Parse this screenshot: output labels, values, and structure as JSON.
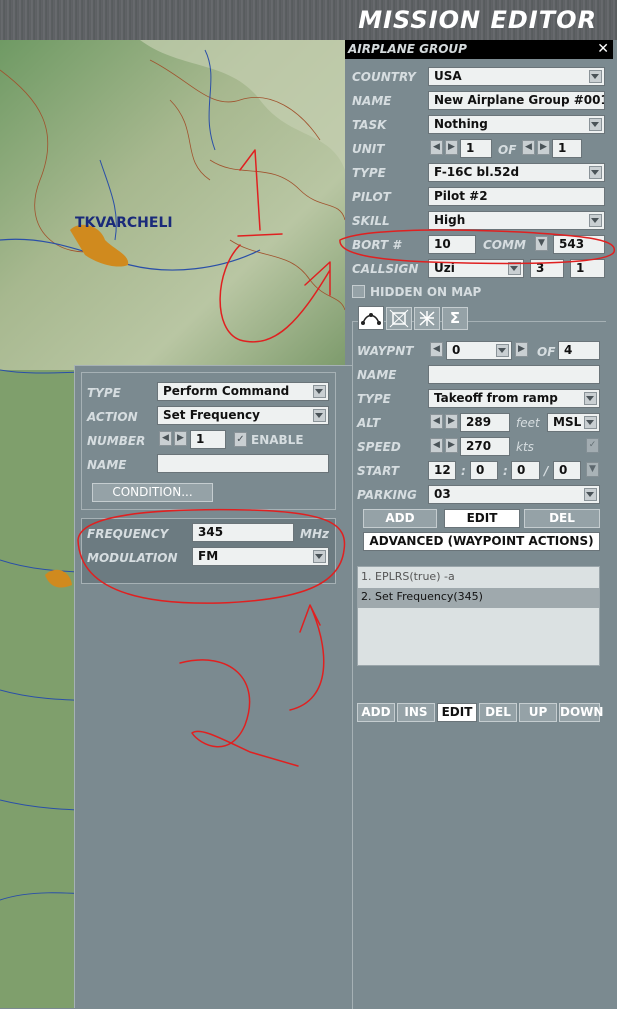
{
  "header": {
    "title": "MISSION EDITOR"
  },
  "map": {
    "city_label": "TKVARCHELI"
  },
  "group_panel": {
    "title": "AIRPLANE GROUP",
    "close": "✕",
    "country_label": "COUNTRY",
    "country": "USA",
    "name_label": "NAME",
    "name": "New Airplane Group #001",
    "task_label": "TASK",
    "task": "Nothing",
    "unit_label": "UNIT",
    "unit": "1",
    "unit_of_label": "OF",
    "unit_total": "1",
    "type_label": "TYPE",
    "type": "F-16C bl.52d",
    "pilot_label": "PILOT",
    "pilot": "Pilot #2",
    "skill_label": "SKILL",
    "skill": "High",
    "bort_label": "BORT #",
    "bort": "10",
    "comm_label": "COMM",
    "comm": "543",
    "callsign_label": "CALLSIGN",
    "callsign": "Uzi",
    "callsign_num1": "3",
    "callsign_num2": "1",
    "hidden_label": "HIDDEN ON MAP"
  },
  "waypoint_panel": {
    "tabs": [
      "route-icon",
      "target-icon",
      "payload-icon",
      "summary-icon"
    ],
    "waypnt_label": "WAYPNT",
    "waypnt": "0",
    "of_label": "OF",
    "waypnt_total": "4",
    "name_label": "NAME",
    "name": "",
    "type_label": "TYPE",
    "type": "Takeoff from ramp",
    "alt_label": "ALT",
    "alt": "289",
    "alt_unit": "feet",
    "alt_ref": "MSL",
    "speed_label": "SPEED",
    "speed": "270",
    "speed_unit": "kts",
    "start_label": "START",
    "start_h": "12",
    "start_m": "0",
    "start_s": "0",
    "start_d": "0",
    "sep1": ":",
    "sep2": ":",
    "sep3": "/",
    "parking_label": "PARKING",
    "parking": "03",
    "add": "ADD",
    "edit": "EDIT",
    "del": "DEL",
    "advanced": "ADVANCED (WAYPOINT ACTIONS)",
    "actions": [
      "1. EPLRS(true)  -a",
      "2. Set Frequency(345)"
    ],
    "bottom_buttons": [
      "ADD",
      "INS",
      "EDIT",
      "DEL",
      "UP",
      "DOWN"
    ]
  },
  "action_panel": {
    "type_label": "TYPE",
    "type": "Perform Command",
    "action_label": "ACTION",
    "action": "Set Frequency",
    "number_label": "NUMBER",
    "number": "1",
    "enable_label": "ENABLE",
    "name_label": "NAME",
    "name": "",
    "condition": "CONDITION...",
    "frequency_label": "FREQUENCY",
    "frequency": "345",
    "frequency_unit": "MHz",
    "modulation_label": "MODULATION",
    "modulation": "FM"
  },
  "colors": {
    "panel": "#7b8a90",
    "annotation": "#e02020",
    "title_bar": "#000000"
  }
}
